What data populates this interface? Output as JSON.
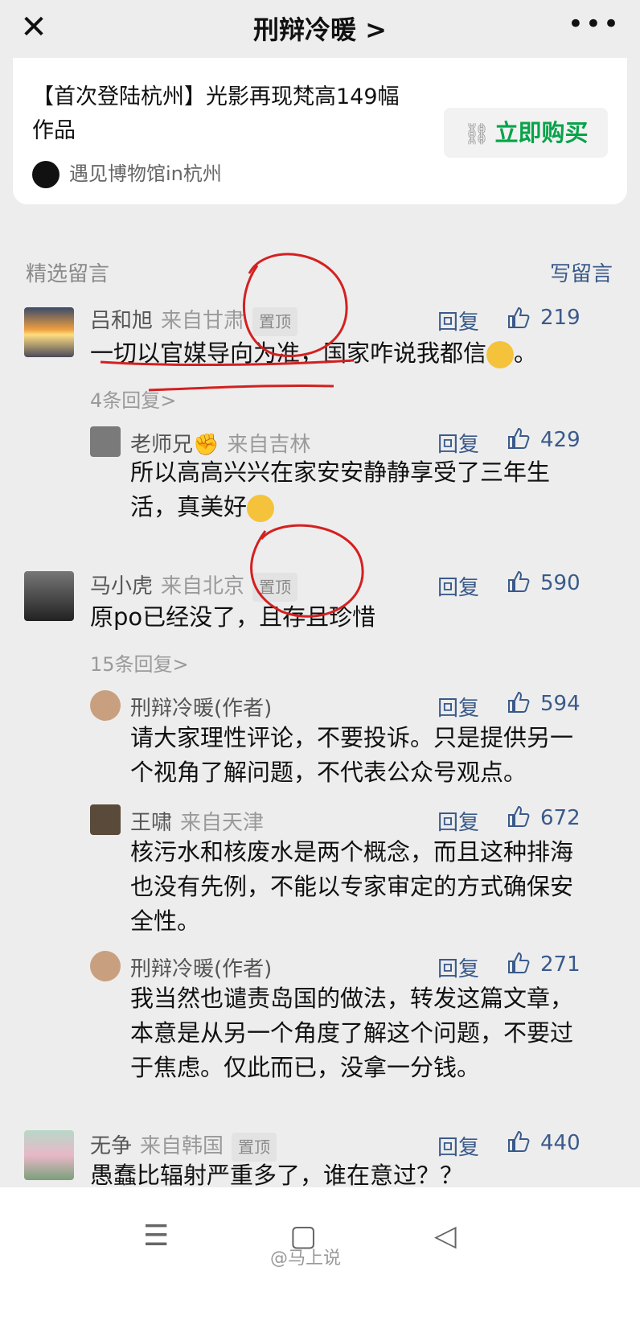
{
  "header": {
    "close_icon": "close-icon",
    "title": "刑辩冷暖 >",
    "more_icon": "more-icon"
  },
  "ad_card": {
    "title": "【首次登陆杭州】光影再现梵高149幅作品",
    "buy_label": "立即购买",
    "source": "遇见博物馆in杭州",
    "link_icon": "link-icon",
    "accent": "#07a34a"
  },
  "section": {
    "label": "精选留言",
    "write_label": "写留言"
  },
  "comments": [
    {
      "name": "吕和旭",
      "location": "来自甘肃",
      "pin": "置顶",
      "reply": "回复",
      "likes": "219",
      "text": "一切以官媒导向为准，国家咋说我都信",
      "emoji": "grin",
      "end": "。",
      "more": "4条回复>",
      "replies": [
        {
          "name": "老师兄",
          "location": "来自吉林",
          "reply": "回复",
          "likes": "429",
          "text": "所以高高兴兴在家安安静静享受了三年生活，真美好"
        }
      ]
    },
    {
      "name": "马小虎",
      "location": "来自北京",
      "pin": "置顶",
      "reply": "回复",
      "likes": "590",
      "text": "原po已经没了，且存且珍惜",
      "more": "15条回复>",
      "replies": [
        {
          "name": "刑辩冷暖(作者)",
          "reply": "回复",
          "likes": "594",
          "text": "请大家理性评论，不要投诉。只是提供另一个视角了解问题，不代表公众号观点。"
        },
        {
          "name": "王啸",
          "location": "来自天津",
          "reply": "回复",
          "likes": "672",
          "text": "核污水和核废水是两个概念，而且这种排海也没有先例，不能以专家审定的方式确保安全性。"
        },
        {
          "name": "刑辩冷暖(作者)",
          "reply": "回复",
          "likes": "271",
          "text": "我当然也谴责岛国的做法，转发这篇文章，本意是从另一个角度了解这个问题，不要过于焦虑。仅此而已，没拿一分钱。"
        }
      ]
    },
    {
      "name": "无争",
      "location": "来自韩国",
      "pin": "置顶",
      "reply": "回复",
      "likes": "440",
      "text": "愚蠢比辐射严重多了，谁在意过？？"
    }
  ],
  "navbar": {
    "menu_icon": "menu-icon",
    "home_icon": "home-icon",
    "back_icon": "back-icon"
  },
  "watermark": "@马上说"
}
